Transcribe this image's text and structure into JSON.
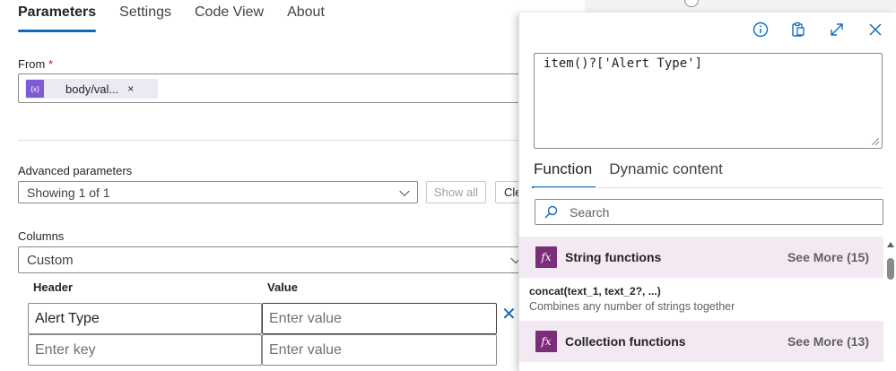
{
  "tabs": [
    {
      "label": "Parameters",
      "active": true
    },
    {
      "label": "Settings",
      "active": false
    },
    {
      "label": "Code View",
      "active": false
    },
    {
      "label": "About",
      "active": false
    }
  ],
  "from": {
    "label": "From",
    "required_mark": "*",
    "token": {
      "label": "body/val...",
      "icon": "dynamic-content-icon",
      "icon_text": "{x}"
    },
    "remove_glyph": "×"
  },
  "advanced": {
    "label": "Advanced parameters",
    "value": "Showing 1 of 1",
    "show_all": "Show all",
    "clear_all": "Cle"
  },
  "columns": {
    "label": "Columns",
    "value": "Custom",
    "header_col": "Header",
    "value_col": "Value",
    "rows": [
      {
        "key": "Alert Type",
        "value_placeholder": "Enter value"
      },
      {
        "key_placeholder": "Enter key",
        "value_placeholder": "Enter value"
      }
    ]
  },
  "expression_panel": {
    "expression": "item()?['Alert Type']",
    "tabs": [
      {
        "label": "Function",
        "active": true
      },
      {
        "label": "Dynamic content",
        "active": false
      }
    ],
    "search_placeholder": "Search",
    "categories": [
      {
        "title": "String functions",
        "see_more": "See More (15)"
      },
      {
        "title": "Collection functions",
        "see_more": "See More (13)"
      }
    ],
    "function": {
      "signature": "concat(text_1, text_2?, ...)",
      "description": "Combines any number of strings together"
    },
    "fx_glyph": "fx"
  },
  "colors": {
    "accent": "#0f6cbd",
    "category_bg": "#f3e9f3",
    "fx_icon": "#7a2e7a",
    "token_icon": "#7e5bd4"
  }
}
